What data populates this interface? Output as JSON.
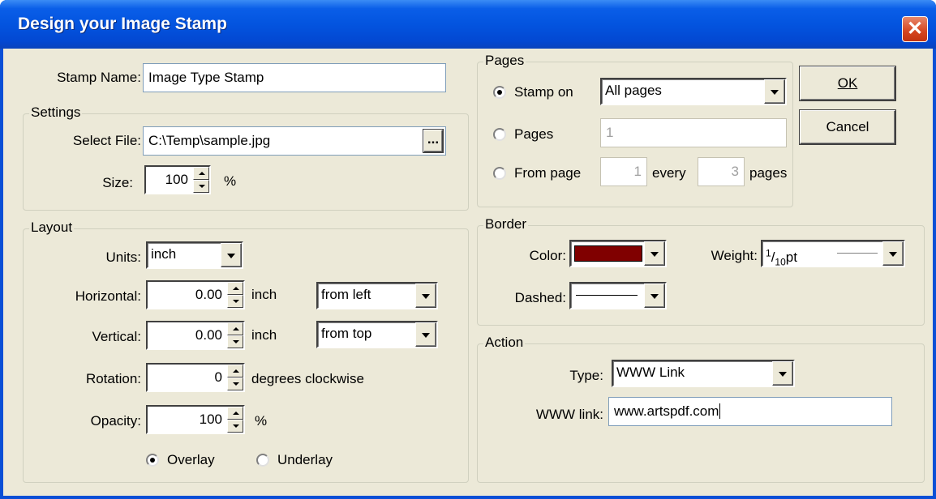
{
  "window": {
    "title": "Design your Image Stamp"
  },
  "stamp_name": {
    "label": "Stamp Name:",
    "value": "Image Type Stamp"
  },
  "settings": {
    "legend": "Settings",
    "select_file_label": "Select File:",
    "file_value": "C:\\Temp\\sample.jpg",
    "browse_label": "...",
    "size_label": "Size:",
    "size_value": "100",
    "size_unit": "%"
  },
  "layout": {
    "legend": "Layout",
    "units_label": "Units:",
    "units_value": "inch",
    "horizontal_label": "Horizontal:",
    "horizontal_value": "0.00",
    "horizontal_unit": "inch",
    "horizontal_from": "from left",
    "vertical_label": "Vertical:",
    "vertical_value": "0.00",
    "vertical_unit": "inch",
    "vertical_from": "from top",
    "rotation_label": "Rotation:",
    "rotation_value": "0",
    "rotation_unit": "degrees clockwise",
    "opacity_label": "Opacity:",
    "opacity_value": "100",
    "opacity_unit": "%",
    "overlay_label": "Overlay",
    "underlay_label": "Underlay",
    "selected": "Overlay"
  },
  "pages": {
    "legend": "Pages",
    "stamp_on_label": "Stamp on",
    "stamp_on_value": "All pages",
    "pages_label": "Pages",
    "pages_value": "1",
    "from_page_label": "From page",
    "from_page_value": "1",
    "every_label": "every",
    "every_value": "3",
    "pages_suffix": "pages",
    "selected": "Stamp on"
  },
  "border": {
    "legend": "Border",
    "color_label": "Color:",
    "color_value": "#800000",
    "weight_label": "Weight:",
    "weight_num": "1",
    "weight_den": "10",
    "weight_unit": "pt",
    "dashed_label": "Dashed:"
  },
  "action": {
    "legend": "Action",
    "type_label": "Type:",
    "type_value": "WWW Link",
    "link_label": "WWW link:",
    "link_value": "www.artspdf.com"
  },
  "buttons": {
    "ok": "OK",
    "cancel": "Cancel"
  }
}
